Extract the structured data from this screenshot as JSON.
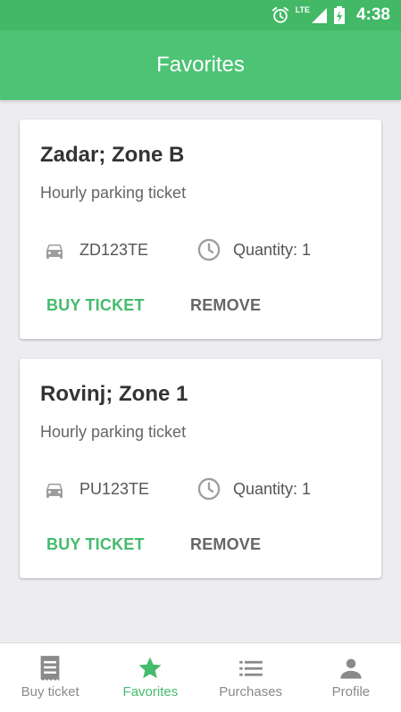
{
  "status_bar": {
    "network_label": "LTE",
    "time": "4:38"
  },
  "header": {
    "title": "Favorites"
  },
  "favorites": [
    {
      "title": "Zadar; Zone B",
      "subtitle": "Hourly parking ticket",
      "plate": "ZD123TE",
      "quantity": "Quantity: 1",
      "buy_label": "BUY TICKET",
      "remove_label": "REMOVE"
    },
    {
      "title": "Rovinj; Zone 1",
      "subtitle": "Hourly parking ticket",
      "plate": "PU123TE",
      "quantity": "Quantity: 1",
      "buy_label": "BUY TICKET",
      "remove_label": "REMOVE"
    }
  ],
  "bottom_nav": {
    "items": [
      {
        "label": "Buy ticket",
        "icon": "ticket-icon"
      },
      {
        "label": "Favorites",
        "icon": "star-icon",
        "active": true
      },
      {
        "label": "Purchases",
        "icon": "list-icon"
      },
      {
        "label": "Profile",
        "icon": "person-icon"
      }
    ]
  },
  "colors": {
    "primary": "#4cc375",
    "status_bar": "#43b866",
    "accent_text": "#45bb6c",
    "background": "#ededf1"
  }
}
